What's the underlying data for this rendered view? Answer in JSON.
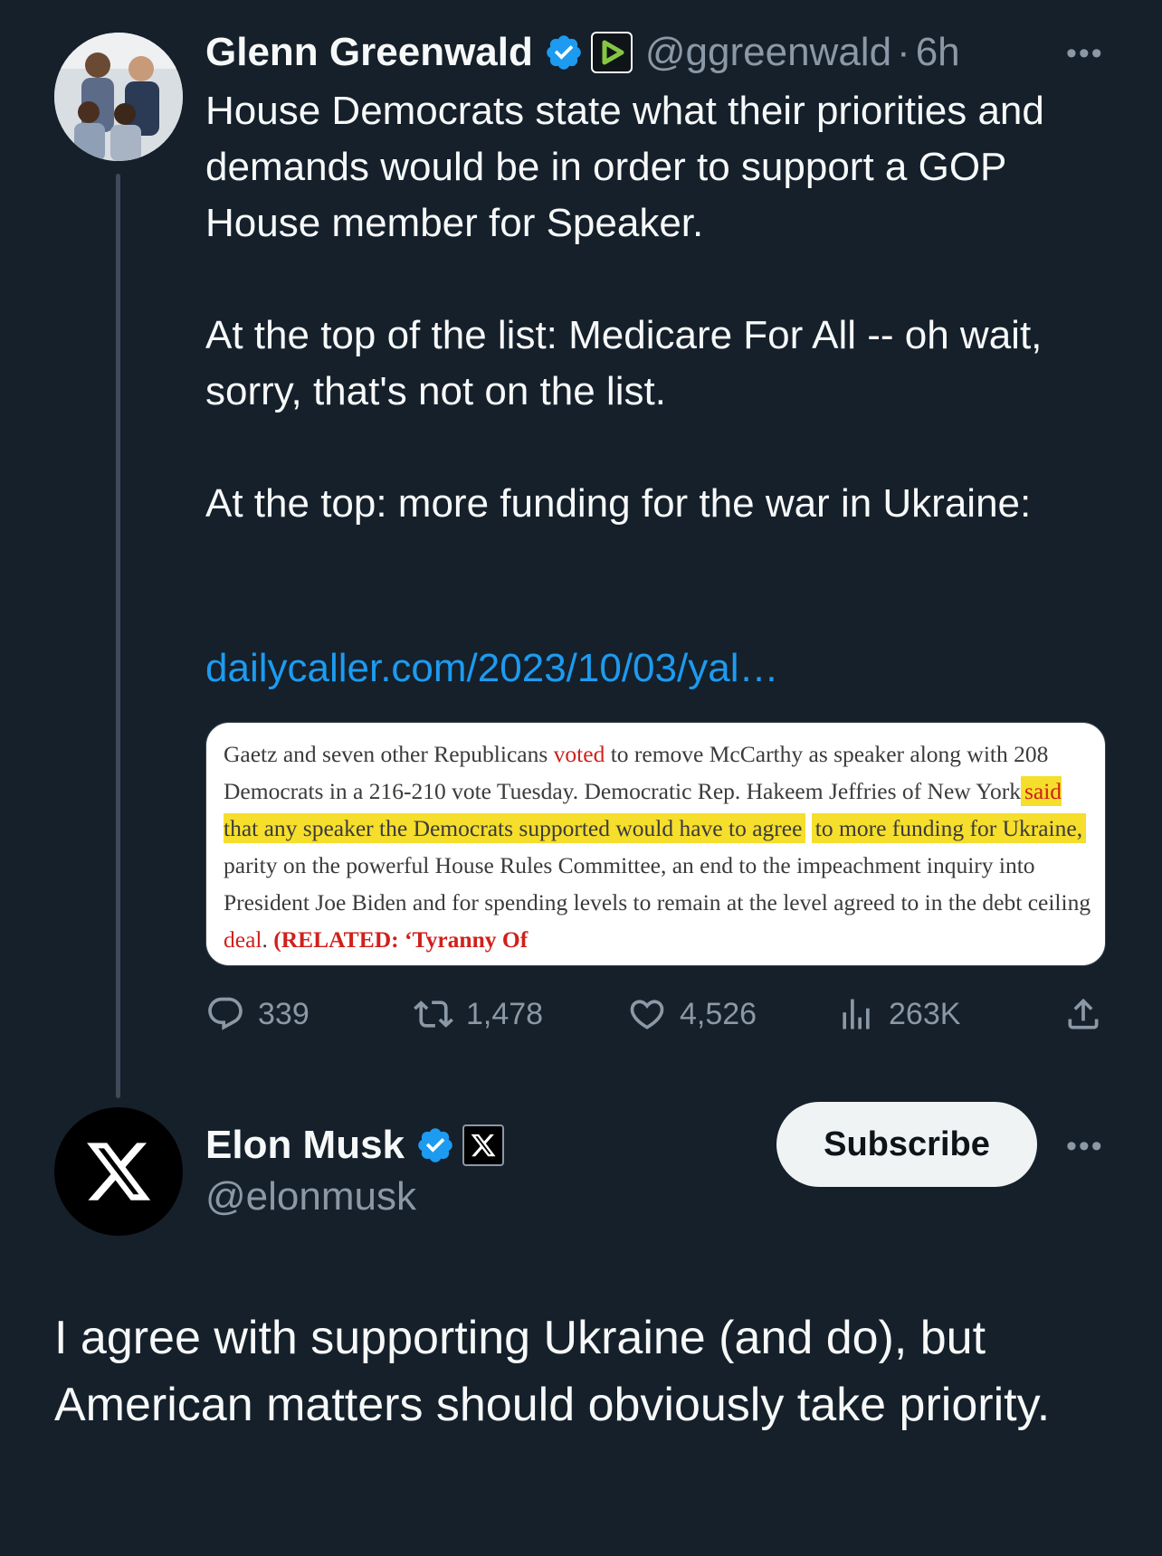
{
  "original_tweet": {
    "display_name": "Glenn Greenwald",
    "handle": "@ggreenwald",
    "separator": "·",
    "time": "6h",
    "more_label": "•••",
    "paragraphs": [
      "House Democrats state what their priorities and demands would be in order to support a GOP House member for Speaker.",
      "At the top of the list: Medicare For All -- oh wait, sorry, that's not on the list.",
      "At the top: more funding for the war in Ukraine:"
    ],
    "link_text": "dailycaller.com/2023/10/03/yal…",
    "card": {
      "t1": "Gaetz and seven other Republicans ",
      "t2": "voted",
      "t3": " to remove McCarthy as speaker along with 208 Democrats in a 216-210 vote Tuesday. Democratic Rep. Hakeem Jeffries of New York",
      "t4": "said",
      "t5": " that any speaker the Democrats supported would have to agree",
      "t6": "to more funding for Ukraine,",
      "t7": " parity on the powerful House Rules Committee, an end to the impeachment inquiry into President Joe Biden and for spending levels to remain at the level agreed to in the debt ceiling ",
      "t8": "deal",
      "t9": ". ",
      "t10": "(RELATED: ‘Tyranny Of"
    },
    "stats": {
      "replies": "339",
      "retweets": "1,478",
      "likes": "4,526",
      "views": "263K"
    },
    "colors": {
      "flag_blue": "#1f66c9",
      "flag_yellow": "#ffd400",
      "link": "#1d9bf0",
      "highlight": "#f6de2c"
    }
  },
  "reply_tweet": {
    "display_name": "Elon Musk",
    "handle": "@elonmusk",
    "more_label": "•••",
    "subscribe_label": "Subscribe",
    "text": "I agree with supporting Ukraine (and do), but American matters should obviously take priority."
  },
  "icons": [
    "verified-badge-icon",
    "rumble-affiliate-icon",
    "x-affiliate-icon",
    "reply-icon",
    "retweet-icon",
    "like-icon",
    "views-icon",
    "share-icon"
  ]
}
